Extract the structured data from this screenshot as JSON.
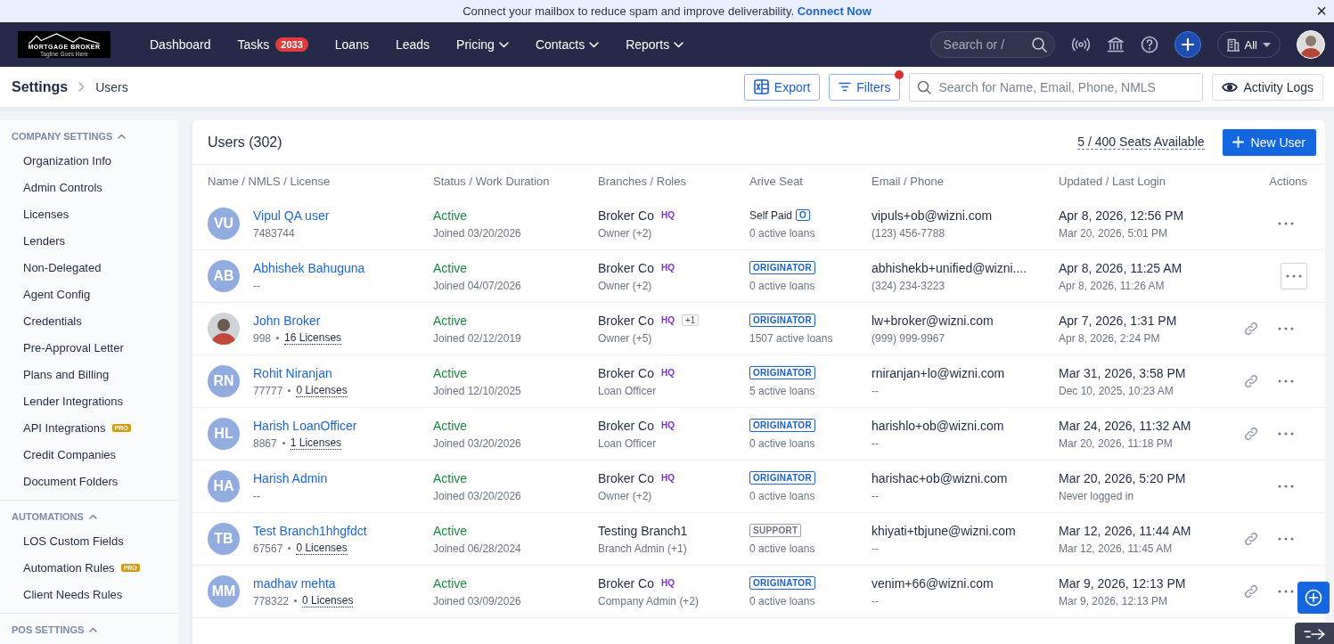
{
  "banner": {
    "text": "Connect your mailbox to reduce spam and improve deliverability.",
    "link": "Connect Now",
    "close": "×"
  },
  "logo": {
    "name": "MORTGAGE BROKER",
    "tagline": "Tagline Goes Here"
  },
  "nav": [
    {
      "label": "Dashboard",
      "dropdown": false
    },
    {
      "label": "Tasks",
      "badge": "2033",
      "dropdown": false
    },
    {
      "label": "Loans",
      "dropdown": false
    },
    {
      "label": "Leads",
      "dropdown": false
    },
    {
      "label": "Pricing",
      "dropdown": true
    },
    {
      "label": "Contacts",
      "dropdown": true
    },
    {
      "label": "Reports",
      "dropdown": true
    }
  ],
  "global_search": {
    "placeholder": "Search or /"
  },
  "scope": {
    "label": "All"
  },
  "breadcrumb": [
    "Settings",
    "Users"
  ],
  "toolbar": {
    "export": "Export",
    "filters": "Filters",
    "filters_active": true,
    "search": {
      "placeholder": "Search for Name, Email, Phone, NMLS"
    },
    "activity": "Activity Logs"
  },
  "sidebar": [
    {
      "title": "COMPANY SETTINGS",
      "expanded": true,
      "items": [
        {
          "label": "Organization Info"
        },
        {
          "label": "Admin Controls"
        },
        {
          "label": "Licenses"
        },
        {
          "label": "Lenders"
        },
        {
          "label": "Non-Delegated"
        },
        {
          "label": "Agent Config"
        },
        {
          "label": "Credentials"
        },
        {
          "label": "Pre-Approval Letter"
        },
        {
          "label": "Plans and Billing"
        },
        {
          "label": "Lender Integrations"
        },
        {
          "label": "API Integrations",
          "pro": "PRO"
        },
        {
          "label": "Credit Companies"
        },
        {
          "label": "Document Folders"
        }
      ]
    },
    {
      "title": "AUTOMATIONS",
      "expanded": true,
      "items": [
        {
          "label": "LOS Custom Fields"
        },
        {
          "label": "Automation Rules",
          "pro": "PRO"
        },
        {
          "label": "Client Needs Rules"
        }
      ]
    },
    {
      "title": "POS SETTINGS",
      "expanded": true
    }
  ],
  "users_title": "Users (302)",
  "seats": "5 / 400 Seats Available",
  "new_user": "New User",
  "columns": [
    "Name / NMLS / License",
    "Status / Work Duration",
    "Branches / Roles",
    "Arive Seat",
    "Email / Phone",
    "Updated / Last Login",
    "Actions"
  ],
  "rows": [
    {
      "avatar": {
        "kind": "initials",
        "text": "VU"
      },
      "name": "Vipul QA user",
      "nmls": "7483744",
      "status": "Active",
      "joined": "Joined 03/20/2026",
      "branch": "Broker Co",
      "hq": "HQ",
      "role": "Owner (+2)",
      "seat": {
        "kind": "self_paid",
        "label": "Self Paid",
        "tag": "O"
      },
      "loans": "0 active loans",
      "email": "vipuls+ob@wizni.com",
      "phone": "(123) 456-7788",
      "updated": "Apr 8, 2026, 12:56 PM",
      "login": "Mar 20, 2026, 5:01 PM",
      "has_link": false,
      "menu_focused": false
    },
    {
      "avatar": {
        "kind": "initials",
        "text": "AB"
      },
      "name": "Abhishek Bahuguna",
      "nmls": "--",
      "status": "Active",
      "joined": "Joined 04/07/2026",
      "branch": "Broker Co",
      "hq": "HQ",
      "role": "Owner (+2)",
      "seat": {
        "kind": "originator",
        "tag": "ORIGINATOR"
      },
      "loans": "0 active loans",
      "email": "abhishekb+unified@wizni....",
      "phone": "(324) 234-3223",
      "updated": "Apr 8, 2026, 11:25 AM",
      "login": "Apr 8, 2026, 11:26 AM",
      "has_link": false,
      "menu_focused": true
    },
    {
      "avatar": {
        "kind": "photo"
      },
      "name": "John Broker",
      "nmls": "998",
      "licenses": "16 Licenses",
      "status": "Active",
      "joined": "Joined 02/12/2019",
      "branch": "Broker Co",
      "hq": "HQ",
      "extra": "+1",
      "role": "Owner (+5)",
      "seat": {
        "kind": "originator",
        "tag": "ORIGINATOR"
      },
      "loans": "1507 active loans",
      "email": "lw+broker@wizni.com",
      "phone": "(999) 999-9967",
      "updated": "Apr 7, 2026, 1:31 PM",
      "login": "Apr 8, 2026, 2:24 PM",
      "has_link": true,
      "menu_focused": false
    },
    {
      "avatar": {
        "kind": "initials",
        "text": "RN"
      },
      "name": "Rohit Niranjan",
      "nmls": "77777",
      "licenses": "0 Licenses",
      "status": "Active",
      "joined": "Joined 12/10/2025",
      "branch": "Broker Co",
      "hq": "HQ",
      "role": "Loan Officer",
      "seat": {
        "kind": "originator",
        "tag": "ORIGINATOR"
      },
      "loans": "5 active loans",
      "email": "rniranjan+lo@wizni.com",
      "phone": "--",
      "updated": "Mar 31, 2026, 3:58 PM",
      "login": "Dec 10, 2025, 10:23 AM",
      "has_link": true,
      "menu_focused": false
    },
    {
      "avatar": {
        "kind": "initials",
        "text": "HL"
      },
      "name": "Harish LoanOfficer",
      "nmls": "8867",
      "licenses": "1 Licenses",
      "status": "Active",
      "joined": "Joined 03/20/2026",
      "branch": "Broker Co",
      "hq": "HQ",
      "role": "Loan Officer",
      "seat": {
        "kind": "originator",
        "tag": "ORIGINATOR"
      },
      "loans": "0 active loans",
      "email": "harishlo+ob@wizni.com",
      "phone": "--",
      "updated": "Mar 24, 2026, 11:32 AM",
      "login": "Mar 20, 2026, 11:18 PM",
      "has_link": true,
      "menu_focused": false
    },
    {
      "avatar": {
        "kind": "initials",
        "text": "HA"
      },
      "name": "Harish Admin",
      "nmls": "--",
      "status": "Active",
      "joined": "Joined 03/20/2026",
      "branch": "Broker Co",
      "hq": "HQ",
      "role": "Owner (+2)",
      "seat": {
        "kind": "originator",
        "tag": "ORIGINATOR"
      },
      "loans": "0 active loans",
      "email": "harishac+ob@wizni.com",
      "phone": "--",
      "updated": "Mar 20, 2026, 5:20 PM",
      "login": "Never logged in",
      "has_link": false,
      "menu_focused": false
    },
    {
      "avatar": {
        "kind": "initials",
        "text": "TB"
      },
      "name": "Test Branch1hhgfdct",
      "nmls": "67567",
      "licenses": "0 Licenses",
      "status": "Active",
      "joined": "Joined 06/28/2024",
      "branch": "Testing Branch1",
      "role": "Branch Admin (+1)",
      "seat": {
        "kind": "support",
        "tag": "SUPPORT"
      },
      "loans": "0 active loans",
      "email": "khiyati+tbjune@wizni.com",
      "phone": "--",
      "updated": "Mar 12, 2026, 11:44 AM",
      "login": "Mar 12, 2026, 11:45 AM",
      "has_link": true,
      "menu_focused": false
    },
    {
      "avatar": {
        "kind": "initials",
        "text": "MM"
      },
      "name": "madhav mehta",
      "nmls": "778322",
      "licenses": "0 Licenses",
      "status": "Active",
      "joined": "Joined 03/09/2026",
      "branch": "Broker Co",
      "hq": "HQ",
      "role": "Company Admin (+2)",
      "seat": {
        "kind": "originator",
        "tag": "ORIGINATOR"
      },
      "loans": "0 active loans",
      "email": "venim+66@wizni.com",
      "phone": "--",
      "updated": "Mar 9, 2026, 12:13 PM",
      "login": "Mar 9, 2026, 12:13 PM",
      "has_link": true,
      "menu_focused": false
    }
  ]
}
